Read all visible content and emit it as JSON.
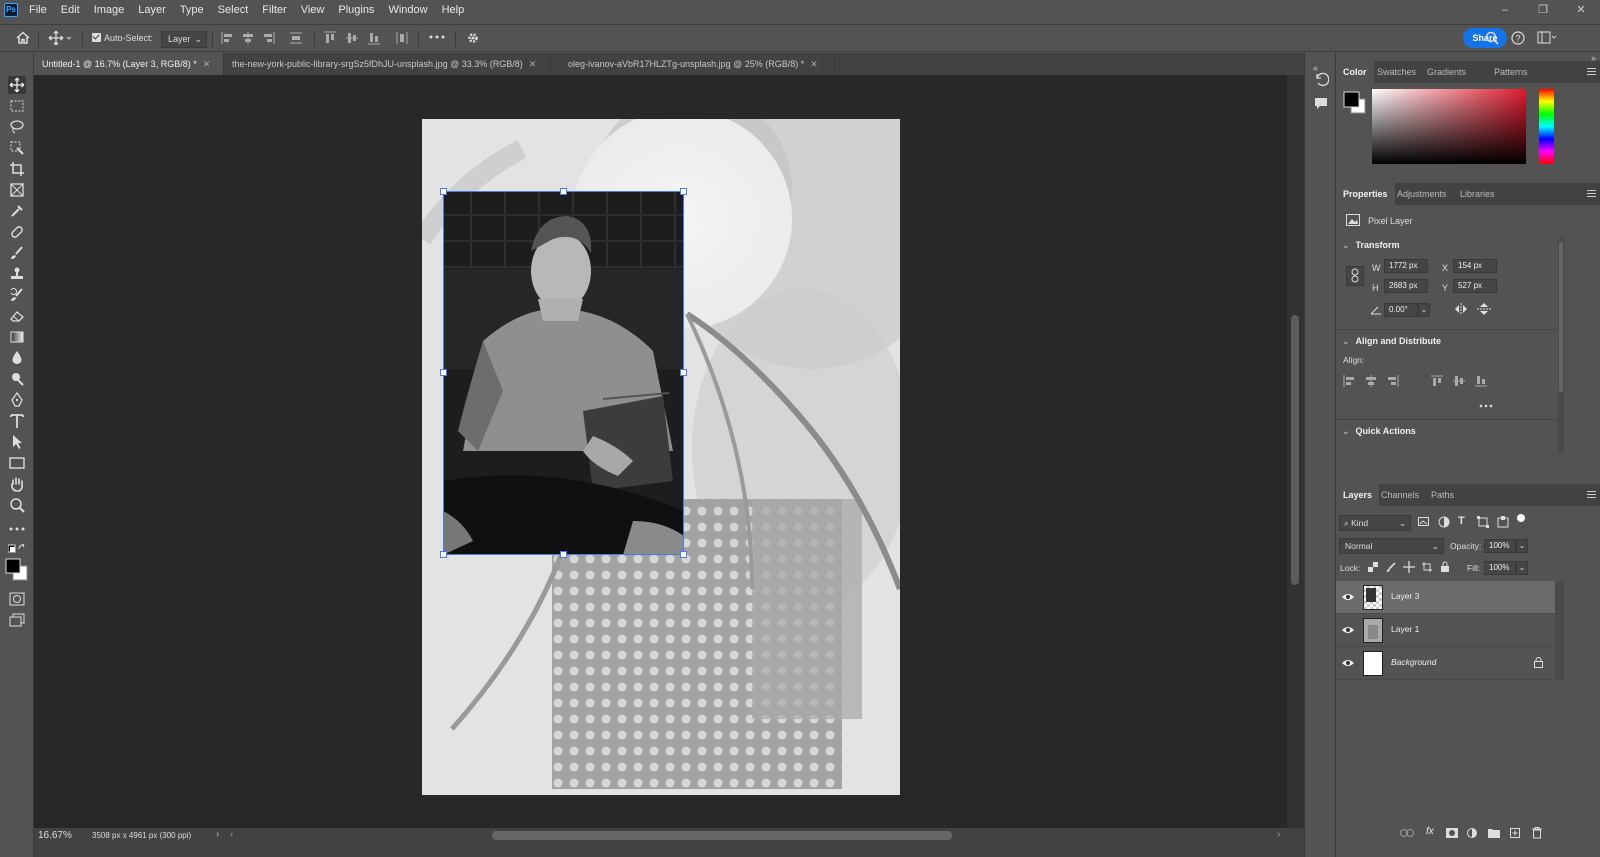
{
  "app": {
    "logo": "Ps"
  },
  "menu": [
    "File",
    "Edit",
    "Image",
    "Layer",
    "Type",
    "Select",
    "Filter",
    "View",
    "Plugins",
    "Window",
    "Help"
  ],
  "window_controls": [
    "–",
    "❐",
    "✕"
  ],
  "options": {
    "auto_select_label": "Auto-Select:",
    "auto_select_checked": true,
    "target_value": "Layer",
    "share_label": "Share"
  },
  "tabs": [
    {
      "label": "Untitled-1 @ 16.7% (Layer 3, RGB/8) *",
      "active": true
    },
    {
      "label": "the-new-york-public-library-srgSz5fDhJU-unsplash.jpg @ 33.3% (RGB/8)",
      "active": false
    },
    {
      "label": "oleg-ivanov-aVbR17HLZTg-unsplash.jpg @ 25% (RGB/8) *",
      "active": false
    }
  ],
  "status": {
    "zoom": "16.67%",
    "doc_info": "3508 px x 4961 px (300 ppi)"
  },
  "color_panel": {
    "tabs": [
      "Color",
      "Swatches",
      "Gradients",
      "Patterns"
    ],
    "active": "Color",
    "foreground": "#000000",
    "background": "#ffffff",
    "hue": "#e01b2f"
  },
  "properties": {
    "tabs": [
      "Properties",
      "Adjustments",
      "Libraries"
    ],
    "active": "Properties",
    "layer_kind": "Pixel Layer",
    "transform": {
      "title": "Transform",
      "w_label": "W",
      "w": "1772 px",
      "h_label": "H",
      "h": "2683 px",
      "x_label": "X",
      "x": "154 px",
      "y_label": "Y",
      "y": "527 px",
      "angle": "0.00°"
    },
    "align": {
      "title": "Align and Distribute",
      "label": "Align:"
    },
    "quick_actions": {
      "title": "Quick Actions"
    }
  },
  "layers_panel": {
    "tabs": [
      "Layers",
      "Channels",
      "Paths"
    ],
    "active": "Layers",
    "filter_kind": "Kind",
    "blend_mode": "Normal",
    "opacity_label": "Opacity:",
    "opacity": "100%",
    "lock_label": "Lock:",
    "fill_label": "Fill:",
    "fill": "100%",
    "layers": [
      {
        "name": "Layer 3",
        "selected": true,
        "locked": false
      },
      {
        "name": "Layer 1",
        "selected": false,
        "locked": false
      },
      {
        "name": "Background",
        "selected": false,
        "locked": true
      }
    ]
  }
}
